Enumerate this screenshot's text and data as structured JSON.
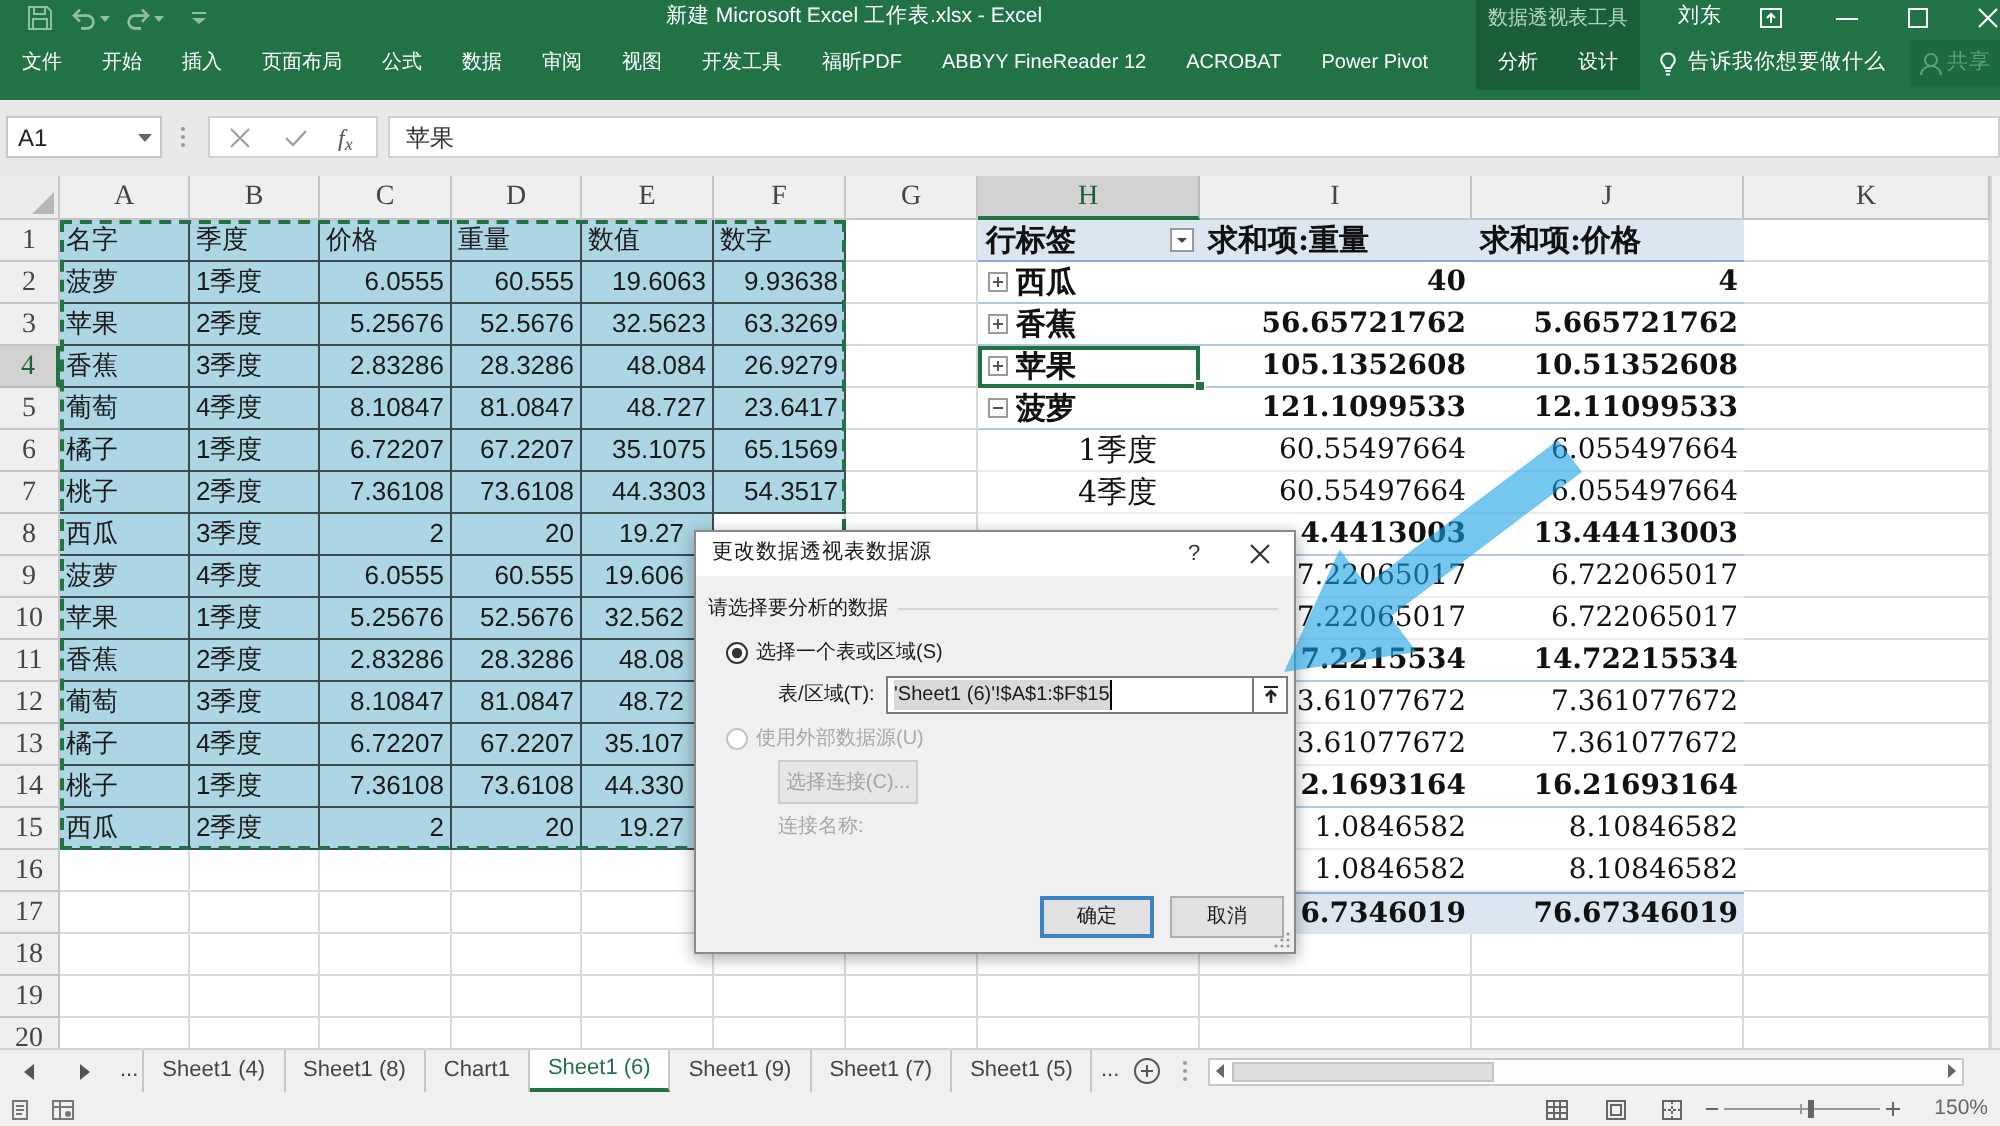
{
  "title_bar": {
    "title": "新建 Microsoft Excel 工作表.xlsx - Excel",
    "context_group": "数据透视表工具",
    "user": "刘东"
  },
  "ribbon_tabs": [
    {
      "label": "文件",
      "contextual": false
    },
    {
      "label": "开始",
      "contextual": false
    },
    {
      "label": "插入",
      "contextual": false
    },
    {
      "label": "页面布局",
      "contextual": false
    },
    {
      "label": "公式",
      "contextual": false
    },
    {
      "label": "数据",
      "contextual": false
    },
    {
      "label": "审阅",
      "contextual": false
    },
    {
      "label": "视图",
      "contextual": false
    },
    {
      "label": "开发工具",
      "contextual": false
    },
    {
      "label": "福昕PDF",
      "contextual": false
    },
    {
      "label": "ABBYY FineReader 12",
      "contextual": false
    },
    {
      "label": "ACROBAT",
      "contextual": false
    },
    {
      "label": "Power Pivot",
      "contextual": false
    },
    {
      "label": "分析",
      "contextual": true
    },
    {
      "label": "设计",
      "contextual": true
    }
  ],
  "tell_me": "告诉我你想要做什么",
  "share_button": {
    "label": "共享",
    "disabled": true
  },
  "formula_bar": {
    "name_box": "A1",
    "insert_function": "f$_{x}$",
    "formula": "苹果"
  },
  "columns": [
    "A",
    "B",
    "C",
    "D",
    "E",
    "F",
    "G",
    "H",
    "I",
    "J",
    "K"
  ],
  "row_numbers": [
    "1",
    "2",
    "3",
    "4",
    "5",
    "6",
    "7",
    "8",
    "9",
    "10",
    "11",
    "12",
    "13",
    "14",
    "15",
    "16",
    "17",
    "18",
    "19",
    "20"
  ],
  "source_table": {
    "rows": [
      [
        "名字",
        "季度",
        "价格",
        "重量",
        "数值",
        "数字"
      ],
      [
        "菠萝",
        "1季度",
        "6.0555",
        "60.555",
        "19.6063",
        "9.93638"
      ],
      [
        "苹果",
        "2季度",
        "5.25676",
        "52.5676",
        "32.5623",
        "63.3269"
      ],
      [
        "香蕉",
        "3季度",
        "2.83286",
        "28.3286",
        "48.084",
        "26.9279"
      ],
      [
        "葡萄",
        "4季度",
        "8.10847",
        "81.0847",
        "48.727",
        "23.6417"
      ],
      [
        "橘子",
        "1季度",
        "6.72207",
        "67.2207",
        "35.1075",
        "65.1569"
      ],
      [
        "桃子",
        "2季度",
        "7.36108",
        "73.6108",
        "44.3303",
        "54.3517"
      ],
      [
        "西瓜",
        "3季度",
        "2",
        "20",
        "19.27"
      ],
      [
        "菠萝",
        "4季度",
        "6.0555",
        "60.555",
        "19.606"
      ],
      [
        "苹果",
        "1季度",
        "5.25676",
        "52.5676",
        "32.562"
      ],
      [
        "香蕉",
        "2季度",
        "2.83286",
        "28.3286",
        "48.08"
      ],
      [
        "葡萄",
        "3季度",
        "8.10847",
        "81.0847",
        "48.72"
      ],
      [
        "橘子",
        "4季度",
        "6.72207",
        "67.2207",
        "35.107"
      ],
      [
        "桃子",
        "1季度",
        "7.36108",
        "73.6108",
        "44.330"
      ],
      [
        "西瓜",
        "2季度",
        "2",
        "20",
        "19.27"
      ]
    ]
  },
  "pivot": {
    "header": [
      "行标签",
      "求和项:重量",
      "求和项:价格"
    ],
    "rows": [
      {
        "kind": "group",
        "label": "西瓜",
        "expanded": false,
        "selected": false,
        "values": [
          "40",
          "4"
        ]
      },
      {
        "kind": "group",
        "label": "香蕉",
        "expanded": false,
        "selected": false,
        "values": [
          "56.65721762",
          "5.665721762"
        ]
      },
      {
        "kind": "group",
        "label": "苹果",
        "expanded": false,
        "selected": true,
        "values": [
          "105.1352608",
          "10.51352608"
        ]
      },
      {
        "kind": "group",
        "label": "菠萝",
        "expanded": true,
        "selected": false,
        "values": [
          "121.1099533",
          "12.11099533"
        ]
      },
      {
        "kind": "item",
        "label": "1季度",
        "selected": false,
        "values": [
          "60.55497664",
          "6.055497664"
        ]
      },
      {
        "kind": "item",
        "label": "4季度",
        "selected": false,
        "values": [
          "60.55497664",
          "6.055497664"
        ]
      },
      {
        "kind": "group",
        "selected": false,
        "values": [
          "4.4413003",
          "13.44413003"
        ]
      },
      {
        "kind": "item",
        "selected": false,
        "values": [
          "7.22065017",
          "6.722065017"
        ]
      },
      {
        "kind": "item",
        "selected": false,
        "values": [
          "7.22065017",
          "6.722065017"
        ]
      },
      {
        "kind": "group",
        "selected": false,
        "values": [
          "7.2215534",
          "14.72215534"
        ]
      },
      {
        "kind": "item",
        "selected": false,
        "values": [
          "3.61077672",
          "7.361077672"
        ]
      },
      {
        "kind": "item",
        "selected": false,
        "values": [
          "3.61077672",
          "7.361077672"
        ]
      },
      {
        "kind": "group",
        "selected": false,
        "values": [
          "2.1693164",
          "16.21693164"
        ]
      },
      {
        "kind": "item",
        "selected": false,
        "values": [
          "1.0846582",
          "8.10846582"
        ]
      },
      {
        "kind": "item",
        "selected": false,
        "values": [
          "1.0846582",
          "8.10846582"
        ]
      },
      {
        "kind": "total",
        "selected": false,
        "values": [
          "6.7346019",
          "76.67346019"
        ]
      }
    ]
  },
  "dialog": {
    "title": "更改数据透视表数据源",
    "help": "?",
    "section": "请选择要分析的数据",
    "options": [
      {
        "label": "选择一个表或区域(S)",
        "selected": true,
        "disabled": false
      },
      {
        "label": "使用外部数据源(U)",
        "selected": false,
        "disabled": true
      }
    ],
    "range_label": "表/区域(T):",
    "range_value": "'Sheet1 (6)'!$A$1:$F$15",
    "connect_button": {
      "label": "选择连接(C)...",
      "disabled": true
    },
    "connection_label": "连接名称:",
    "buttons": [
      {
        "label": "确定",
        "default": true
      },
      {
        "label": "取消",
        "default": false
      }
    ]
  },
  "sheet_tabs": {
    "more_left": "...",
    "tabs": [
      {
        "label": "Sheet1 (4)",
        "selected": false
      },
      {
        "label": "Sheet1 (8)",
        "selected": false
      },
      {
        "label": "Chart1",
        "selected": false
      },
      {
        "label": "Sheet1 (6)",
        "selected": true
      },
      {
        "label": "Sheet1 (9)",
        "selected": false
      },
      {
        "label": "Sheet1 (7)",
        "selected": false
      },
      {
        "label": "Sheet1 (5)",
        "selected": false
      }
    ],
    "more_right": "..."
  },
  "status_bar": {
    "zoom_slider": {
      "level": 0.55
    },
    "zoom": "150%"
  }
}
